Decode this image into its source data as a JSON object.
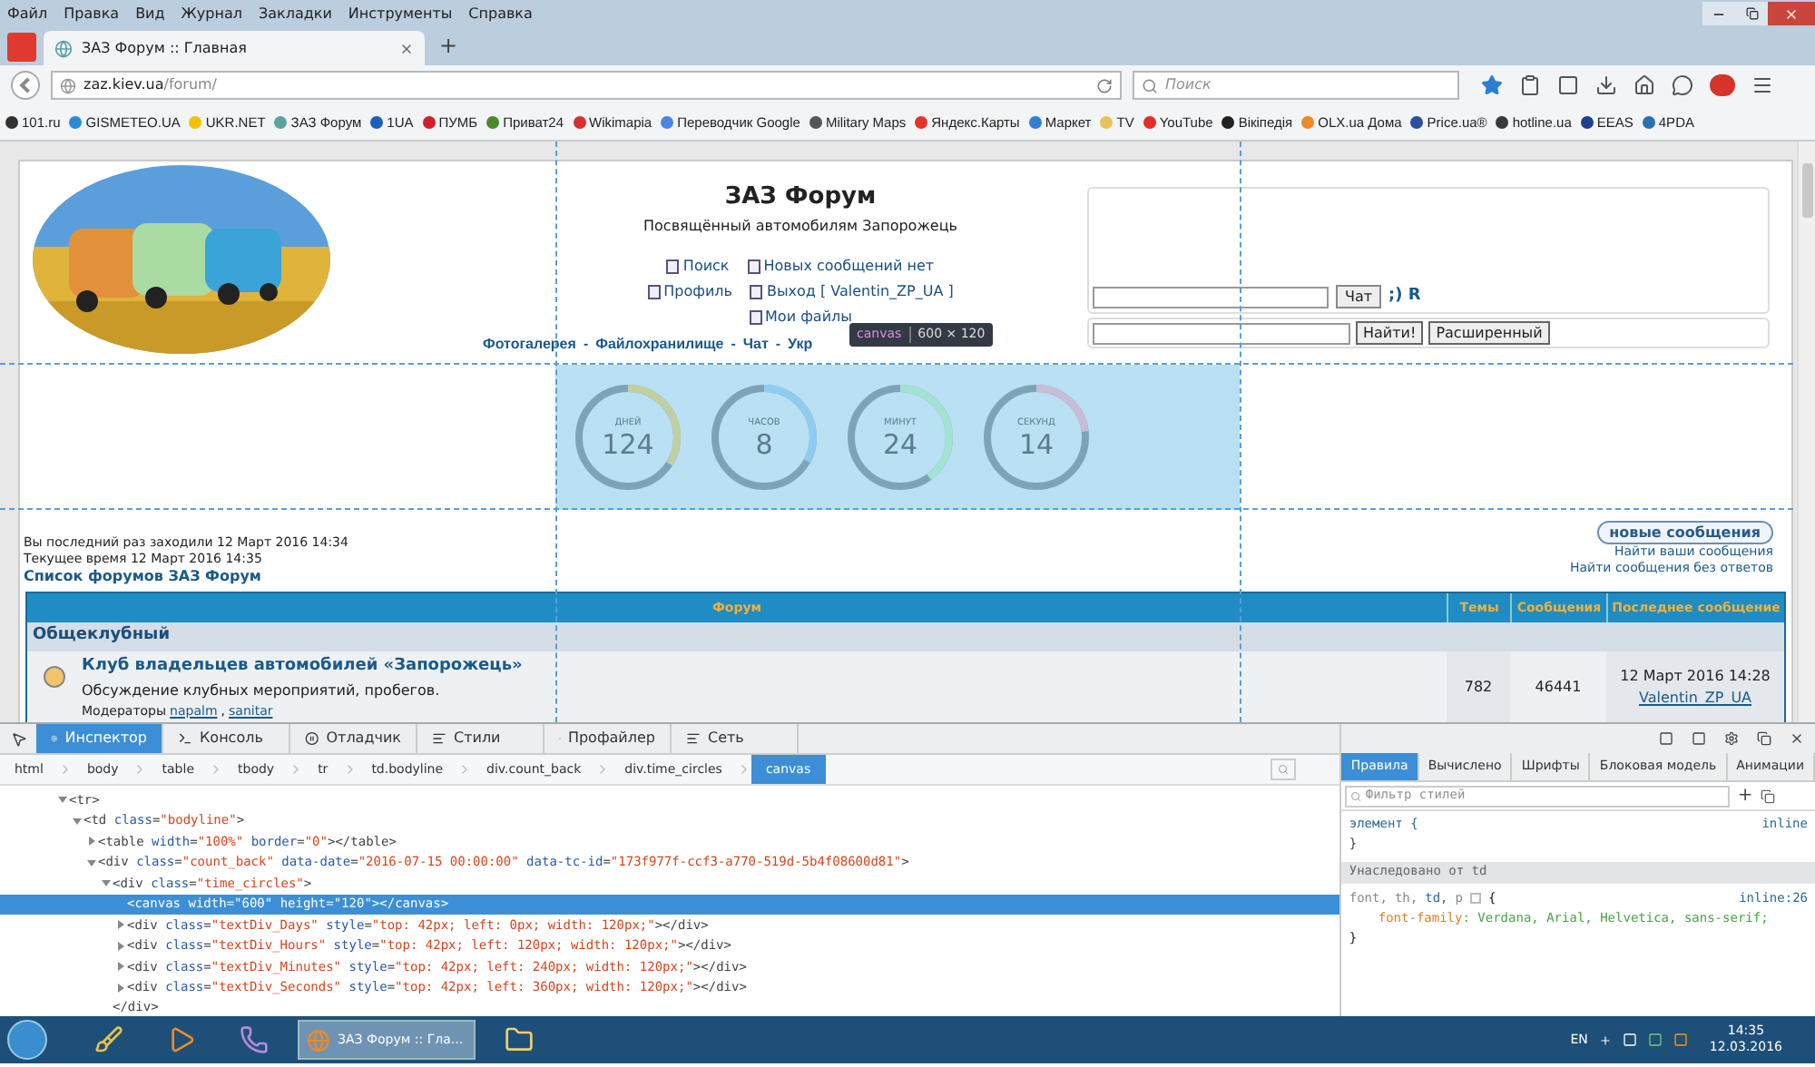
{
  "browser": {
    "menu": [
      "Файл",
      "Правка",
      "Вид",
      "Журнал",
      "Закладки",
      "Инструменты",
      "Справка"
    ],
    "tab": {
      "title": "ЗАЗ Форум :: Главная",
      "selected": true
    },
    "new_tab": "+",
    "url": {
      "host": "zaz.kiev.ua",
      "path": "/forum/"
    },
    "search": {
      "placeholder": "Поиск"
    },
    "bookmarks": [
      {
        "label": "101.ru",
        "color": "#333333"
      },
      {
        "label": "GISMETEO.UA",
        "color": "#2a8ad6"
      },
      {
        "label": "UKR.NET",
        "color": "#f2c200"
      },
      {
        "label": "ЗАЗ Форум",
        "color": "#5aa3a0"
      },
      {
        "label": "1UA",
        "color": "#1d5fb8"
      },
      {
        "label": "ПУМБ",
        "color": "#d21f2a"
      },
      {
        "label": "Приват24",
        "color": "#4b8a2a"
      },
      {
        "label": "Wikimapia",
        "color": "#d8302c"
      },
      {
        "label": "Переводчик Google",
        "color": "#4a86e8"
      },
      {
        "label": "Military Maps",
        "color": "#555555"
      },
      {
        "label": "Яндекс.Карты",
        "color": "#e5332a"
      },
      {
        "label": "Маркет",
        "color": "#2f7fd6"
      },
      {
        "label": "TV",
        "color": "#e8c25a"
      },
      {
        "label": "YouTube",
        "color": "#e52d27"
      },
      {
        "label": "Вікіпедія",
        "color": "#222222"
      },
      {
        "label": "OLX.ua Дома",
        "color": "#f08a24"
      },
      {
        "label": "Price.ua®",
        "color": "#2b4fa2"
      },
      {
        "label": "hotline.ua",
        "color": "#3a3a3a"
      },
      {
        "label": "EEAS",
        "color": "#1f3f8f"
      },
      {
        "label": "4PDA",
        "color": "#2a6fb0"
      }
    ]
  },
  "forum": {
    "title": "ЗАЗ Форум",
    "subtitle": "Посвящённый автомобилям Запорожець",
    "links": [
      [
        {
          "label": "Поиск"
        },
        {
          "label": "Новых сообщений нет"
        }
      ],
      [
        {
          "label": "Профиль"
        },
        {
          "label": "Выход [ Valentin_ZP_UA ]"
        }
      ],
      [
        {
          "label": "Мои файлы"
        }
      ]
    ],
    "nav": [
      "Фотогалерея",
      "Файлохранилище",
      "Чат",
      "Укр"
    ],
    "nav_separator": "-",
    "chat": {
      "button": "Чат",
      "extra": ";) R"
    },
    "search": {
      "button": "Найти!",
      "advanced": "Расширенный"
    },
    "timer": [
      {
        "label": "ДНЕЙ",
        "value": "124",
        "level": 0.34,
        "color": "#c2cfa0"
      },
      {
        "label": "ЧАСОВ",
        "value": "8",
        "level": 0.33,
        "color": "#8fcdf0"
      },
      {
        "label": "МИНУТ",
        "value": "24",
        "level": 0.4,
        "color": "#a3e3d3"
      },
      {
        "label": "СЕКУНД",
        "value": "14",
        "level": 0.23,
        "color": "#c9bcd6"
      }
    ],
    "highlight": {
      "tag": "canvas",
      "size": "600 × 120"
    },
    "visit": {
      "last": "Вы последний раз заходили 12 Март 2016 14:34",
      "current": "Текущее время 12 Март 2016 14:35",
      "index_link": "Список форумов ЗАЗ Форум"
    },
    "actions": {
      "new_posts": "новые сообщения",
      "links": [
        "Найти ваши сообщения",
        "Найти сообщения без ответов"
      ]
    },
    "table": {
      "columns": [
        "Форум",
        "Темы",
        "Сообщения",
        "Последнее сообщение"
      ],
      "category": "Общеклубный",
      "rows": [
        {
          "title": "Клуб владельцев автомобилей «Запорожець»",
          "description": "Обсуждение клубных мероприятий, пробегов.",
          "moderators_label": "Модераторы",
          "moderators": [
            "napalm",
            "sanitar"
          ],
          "moderator_separator": ",",
          "topics": "782",
          "posts": "46441",
          "last_date": "12 Март 2016 14:28",
          "last_user": "Valentin_ZP_UA"
        }
      ]
    }
  },
  "devtools": {
    "tools": [
      {
        "label": "Инспектор",
        "selected": true
      },
      {
        "label": "Консоль",
        "selected": false
      },
      {
        "label": "Отладчик",
        "selected": false
      },
      {
        "label": "Стили",
        "selected": false
      },
      {
        "label": "Профайлер",
        "selected": false
      },
      {
        "label": "Сеть",
        "selected": false
      }
    ],
    "breadcrumbs": [
      {
        "label": "html",
        "selected": false
      },
      {
        "label": "body",
        "selected": false
      },
      {
        "label": "table",
        "selected": false
      },
      {
        "label": "tbody",
        "selected": false
      },
      {
        "label": "tr",
        "selected": false
      },
      {
        "label": "td.bodyline",
        "selected": false
      },
      {
        "label": "div.count_back",
        "selected": false
      },
      {
        "label": "div.time_circles",
        "selected": false
      },
      {
        "label": "canvas",
        "selected": true
      }
    ],
    "markup": [
      {
        "text": "<tr>",
        "expanded": true,
        "selected": false,
        "children": [
          {
            "text": "<td class=\"bodyline\">",
            "expanded": true,
            "selected": false,
            "children": [
              {
                "text": "<table width=\"100%\" border=\"0\"></table>",
                "expanded": false,
                "selected": false
              },
              {
                "text": "<div class=\"count_back\" data-date=\"2016-07-15 00:00:00\" data-tc-id=\"173f977f-ccf3-a770-519d-5b4f08600d81\">",
                "expanded": true,
                "selected": false,
                "children": [
                  {
                    "text": "<div class=\"time_circles\">",
                    "expanded": true,
                    "selected": false,
                    "closing": "</div>",
                    "children": [
                      {
                        "text": "<canvas width=\"600\" height=\"120\"></canvas>",
                        "selected": true
                      },
                      {
                        "text": "<div class=\"textDiv_Days\" style=\"top: 42px; left: 0px; width: 120px;\"></div>",
                        "expanded": false,
                        "selected": false
                      },
                      {
                        "text": "<div class=\"textDiv_Hours\" style=\"top: 42px; left: 120px; width: 120px;\"></div>",
                        "expanded": false,
                        "selected": false
                      },
                      {
                        "text": "<div class=\"textDiv_Minutes\" style=\"top: 42px; left: 240px; width: 120px;\"></div>",
                        "expanded": false,
                        "selected": false
                      },
                      {
                        "text": "<div class=\"textDiv_Seconds\" style=\"top: 42px; left: 360px; width: 120px;\"></div>",
                        "expanded": false,
                        "selected": false
                      }
                    ]
                  }
                ]
              }
            ]
          }
        ]
      }
    ],
    "side_tabs": [
      {
        "label": "Правила",
        "selected": true
      },
      {
        "label": "Вычислено",
        "selected": false
      },
      {
        "label": "Шрифты",
        "selected": false
      },
      {
        "label": "Блоковая модель",
        "selected": false
      },
      {
        "label": "Анимации",
        "selected": false
      }
    ],
    "filter": {
      "placeholder": "Фильтр стилей"
    },
    "add": "+",
    "element_rule": {
      "selector": "элемент {",
      "source": "inline",
      "close": "}"
    },
    "inherited": "Унаследовано от td",
    "rule": {
      "selector": [
        {
          "text": "font,",
          "kind": "plain"
        },
        {
          "text": "th,",
          "kind": "plain"
        },
        {
          "text": "td,",
          "kind": "match"
        },
        {
          "text": "p",
          "kind": "plain"
        }
      ],
      "open": "{",
      "source": "inline:26",
      "property": "font-family",
      "value": ": Verdana, Arial, Helvetica, sans-serif;",
      "close": "}"
    }
  },
  "taskbar": {
    "task": "ЗАЗ Форум :: Гла...",
    "lang": "EN",
    "time": "14:35",
    "date": "12.03.2016"
  }
}
